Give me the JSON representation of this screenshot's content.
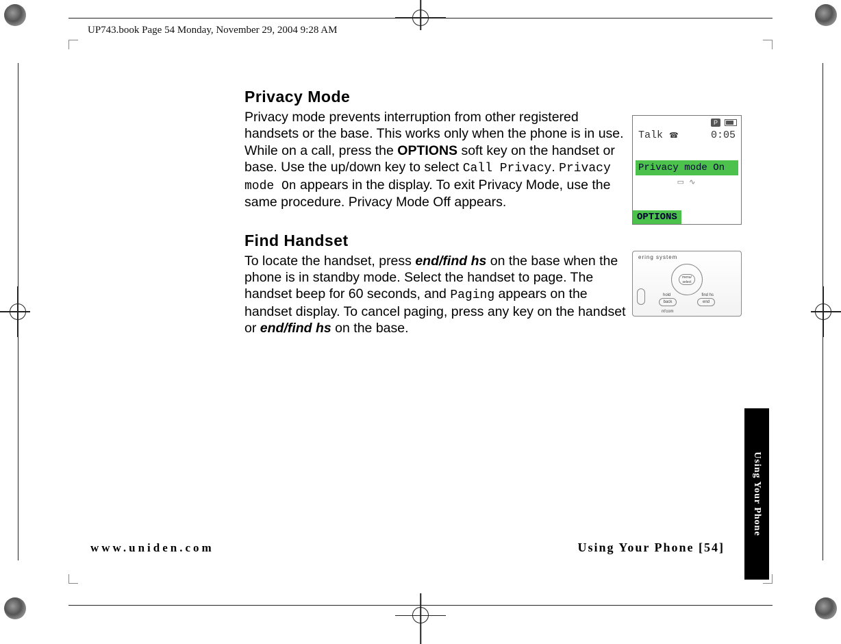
{
  "print_header": "UP743.book  Page 54  Monday, November 29, 2004  9:28 AM",
  "section1": {
    "heading": "Privacy Mode",
    "p_a": "Privacy mode prevents interruption from other registered handsets or the base. This works only when the phone is in use. While on a call, press the ",
    "options_bold": "OPTIONS",
    "p_b": " soft key on the handset or base. Use the up/down key to select ",
    "mono1": "Call Privacy",
    "p_c": ". ",
    "mono2": "Privacy mode On",
    "p_d": " appears in the display. To exit Privacy Mode, use the same procedure. Privacy Mode Off appears."
  },
  "section2": {
    "heading": "Find Handset",
    "p_a": "To locate the handset, press ",
    "em1": "end/find hs",
    "p_b": " on the base when the phone is in standby mode. Select the handset to page. The handset beep for 60 seconds, and ",
    "mono1": "Paging",
    "p_c": " appears on the handset display. To cancel paging, press any key on the handset or ",
    "em2": "end/find hs",
    "p_d": " on the base."
  },
  "phone_screen": {
    "p_icon": "P",
    "status_left": "Talk",
    "status_right": "0:05",
    "banner": "Privacy mode On",
    "softkey": "OPTIONS"
  },
  "base": {
    "label": "ering  system",
    "center1": "menu/",
    "center2": "select",
    "btn1": "back",
    "btn2": "end",
    "lbl1": "hold",
    "lbl2": "find hs",
    "lbl3": "nt'com"
  },
  "footer": {
    "left": "www.uniden.com",
    "right": "Using Your Phone [54]",
    "tab": "Using Your Phone"
  }
}
